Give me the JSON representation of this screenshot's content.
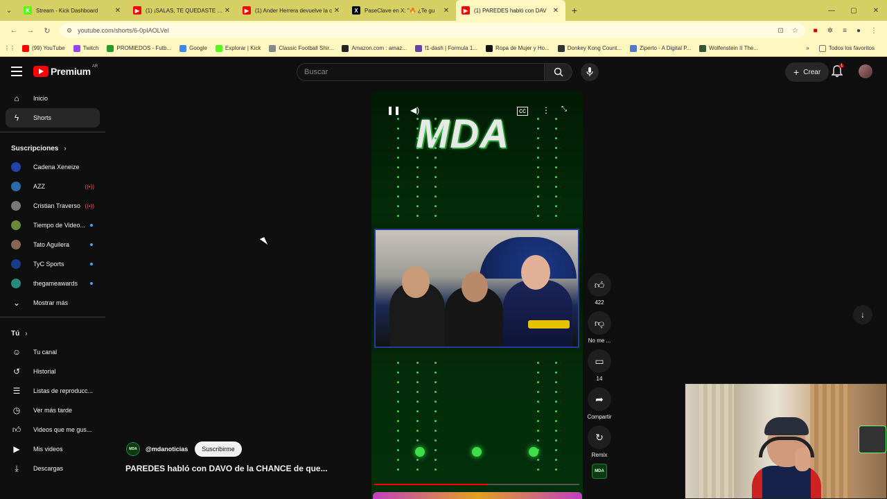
{
  "browser": {
    "tabs": [
      {
        "title": "Stream - Kick Dashboard",
        "favicon_color": "#53fc18",
        "favicon_letter": "K",
        "active": false
      },
      {
        "title": "(1) ¡SALAS, TE QUEDASTE CON",
        "favicon_color": "#ff0000",
        "favicon_letter": "▶",
        "active": false
      },
      {
        "title": "(1) Ander Herrera devuelve la c",
        "favicon_color": "#ff0000",
        "favicon_letter": "▶",
        "active": false
      },
      {
        "title": "PaseClave en X: \"🔥 ¿Te gu",
        "favicon_color": "#000000",
        "favicon_letter": "X",
        "active": false
      },
      {
        "title": "(1) PAREDES habló con DAV",
        "favicon_color": "#ff0000",
        "favicon_letter": "▶",
        "active": true
      }
    ],
    "url": "youtube.com/shorts/6-0pIAOLVeI",
    "bookmarks": [
      {
        "label": "(99) YouTube",
        "color": "#ff0000"
      },
      {
        "label": "Twitch",
        "color": "#9146ff"
      },
      {
        "label": "PROMIEDOS - Futb...",
        "color": "#2a9a2a"
      },
      {
        "label": "Google",
        "color": "#4285f4"
      },
      {
        "label": "Explorar | Kick",
        "color": "#53fc18"
      },
      {
        "label": "Classic Football Shir...",
        "color": "#888888"
      },
      {
        "label": "Amazon.com : amaz...",
        "color": "#222222"
      },
      {
        "label": "f1-dash | Formula 1...",
        "color": "#6644aa"
      },
      {
        "label": "Ropa de Mujer y Ho...",
        "color": "#111111"
      },
      {
        "label": "Donkey Kong Count...",
        "color": "#333333"
      },
      {
        "label": "Ziperto - A Digital P...",
        "color": "#5577cc"
      },
      {
        "label": "Wolfenstein II The...",
        "color": "#335533"
      }
    ],
    "all_bookmarks": "Todos los favoritos"
  },
  "youtube": {
    "brand": "Premium",
    "country": "AR",
    "search_placeholder": "Buscar",
    "create_label": "Crear",
    "notif_count": "1",
    "sidebar": {
      "main": [
        {
          "label": "Inicio",
          "icon": "home-icon"
        },
        {
          "label": "Shorts",
          "icon": "shorts-icon"
        }
      ],
      "subs_title": "Suscripciones",
      "subs": [
        {
          "label": "Cadena Xeneize",
          "color": "#2244aa",
          "status": ""
        },
        {
          "label": "AZZ",
          "color": "#2a6aaa",
          "status": "live"
        },
        {
          "label": "Cristian Traverso",
          "color": "#777777",
          "status": "live"
        },
        {
          "label": "Tiempo de Video...",
          "color": "#6a8a3a",
          "status": "new"
        },
        {
          "label": "Tato Aguilera",
          "color": "#886655",
          "status": "new"
        },
        {
          "label": "TyC Sports",
          "color": "#1a3a8a",
          "status": "new"
        },
        {
          "label": "thegameawards",
          "color": "#2a8a7a",
          "status": "new"
        }
      ],
      "show_more": "Mostrar más",
      "you_title": "Tú",
      "you": [
        {
          "label": "Tu canal",
          "icon": "channel-icon"
        },
        {
          "label": "Historial",
          "icon": "history-icon"
        },
        {
          "label": "Listas de reproducc...",
          "icon": "playlists-icon"
        },
        {
          "label": "Ver más tarde",
          "icon": "watch-later-icon"
        },
        {
          "label": "Videos que me gus...",
          "icon": "liked-icon"
        },
        {
          "label": "Mis videos",
          "icon": "my-videos-icon"
        },
        {
          "label": "Descargas",
          "icon": "downloads-icon"
        }
      ]
    },
    "short": {
      "overlay_text": "MDA",
      "channel_avatar": "MDA",
      "handle": "@mdanoticias",
      "subscribe": "Suscribirme",
      "title": "PAREDES habló con DAVO de la CHANCE de que...",
      "progress": 0.55
    },
    "actions": {
      "likes": "422",
      "dislike": "No me ...",
      "comments": "14",
      "share": "Compartir",
      "remix": "Remix"
    }
  }
}
